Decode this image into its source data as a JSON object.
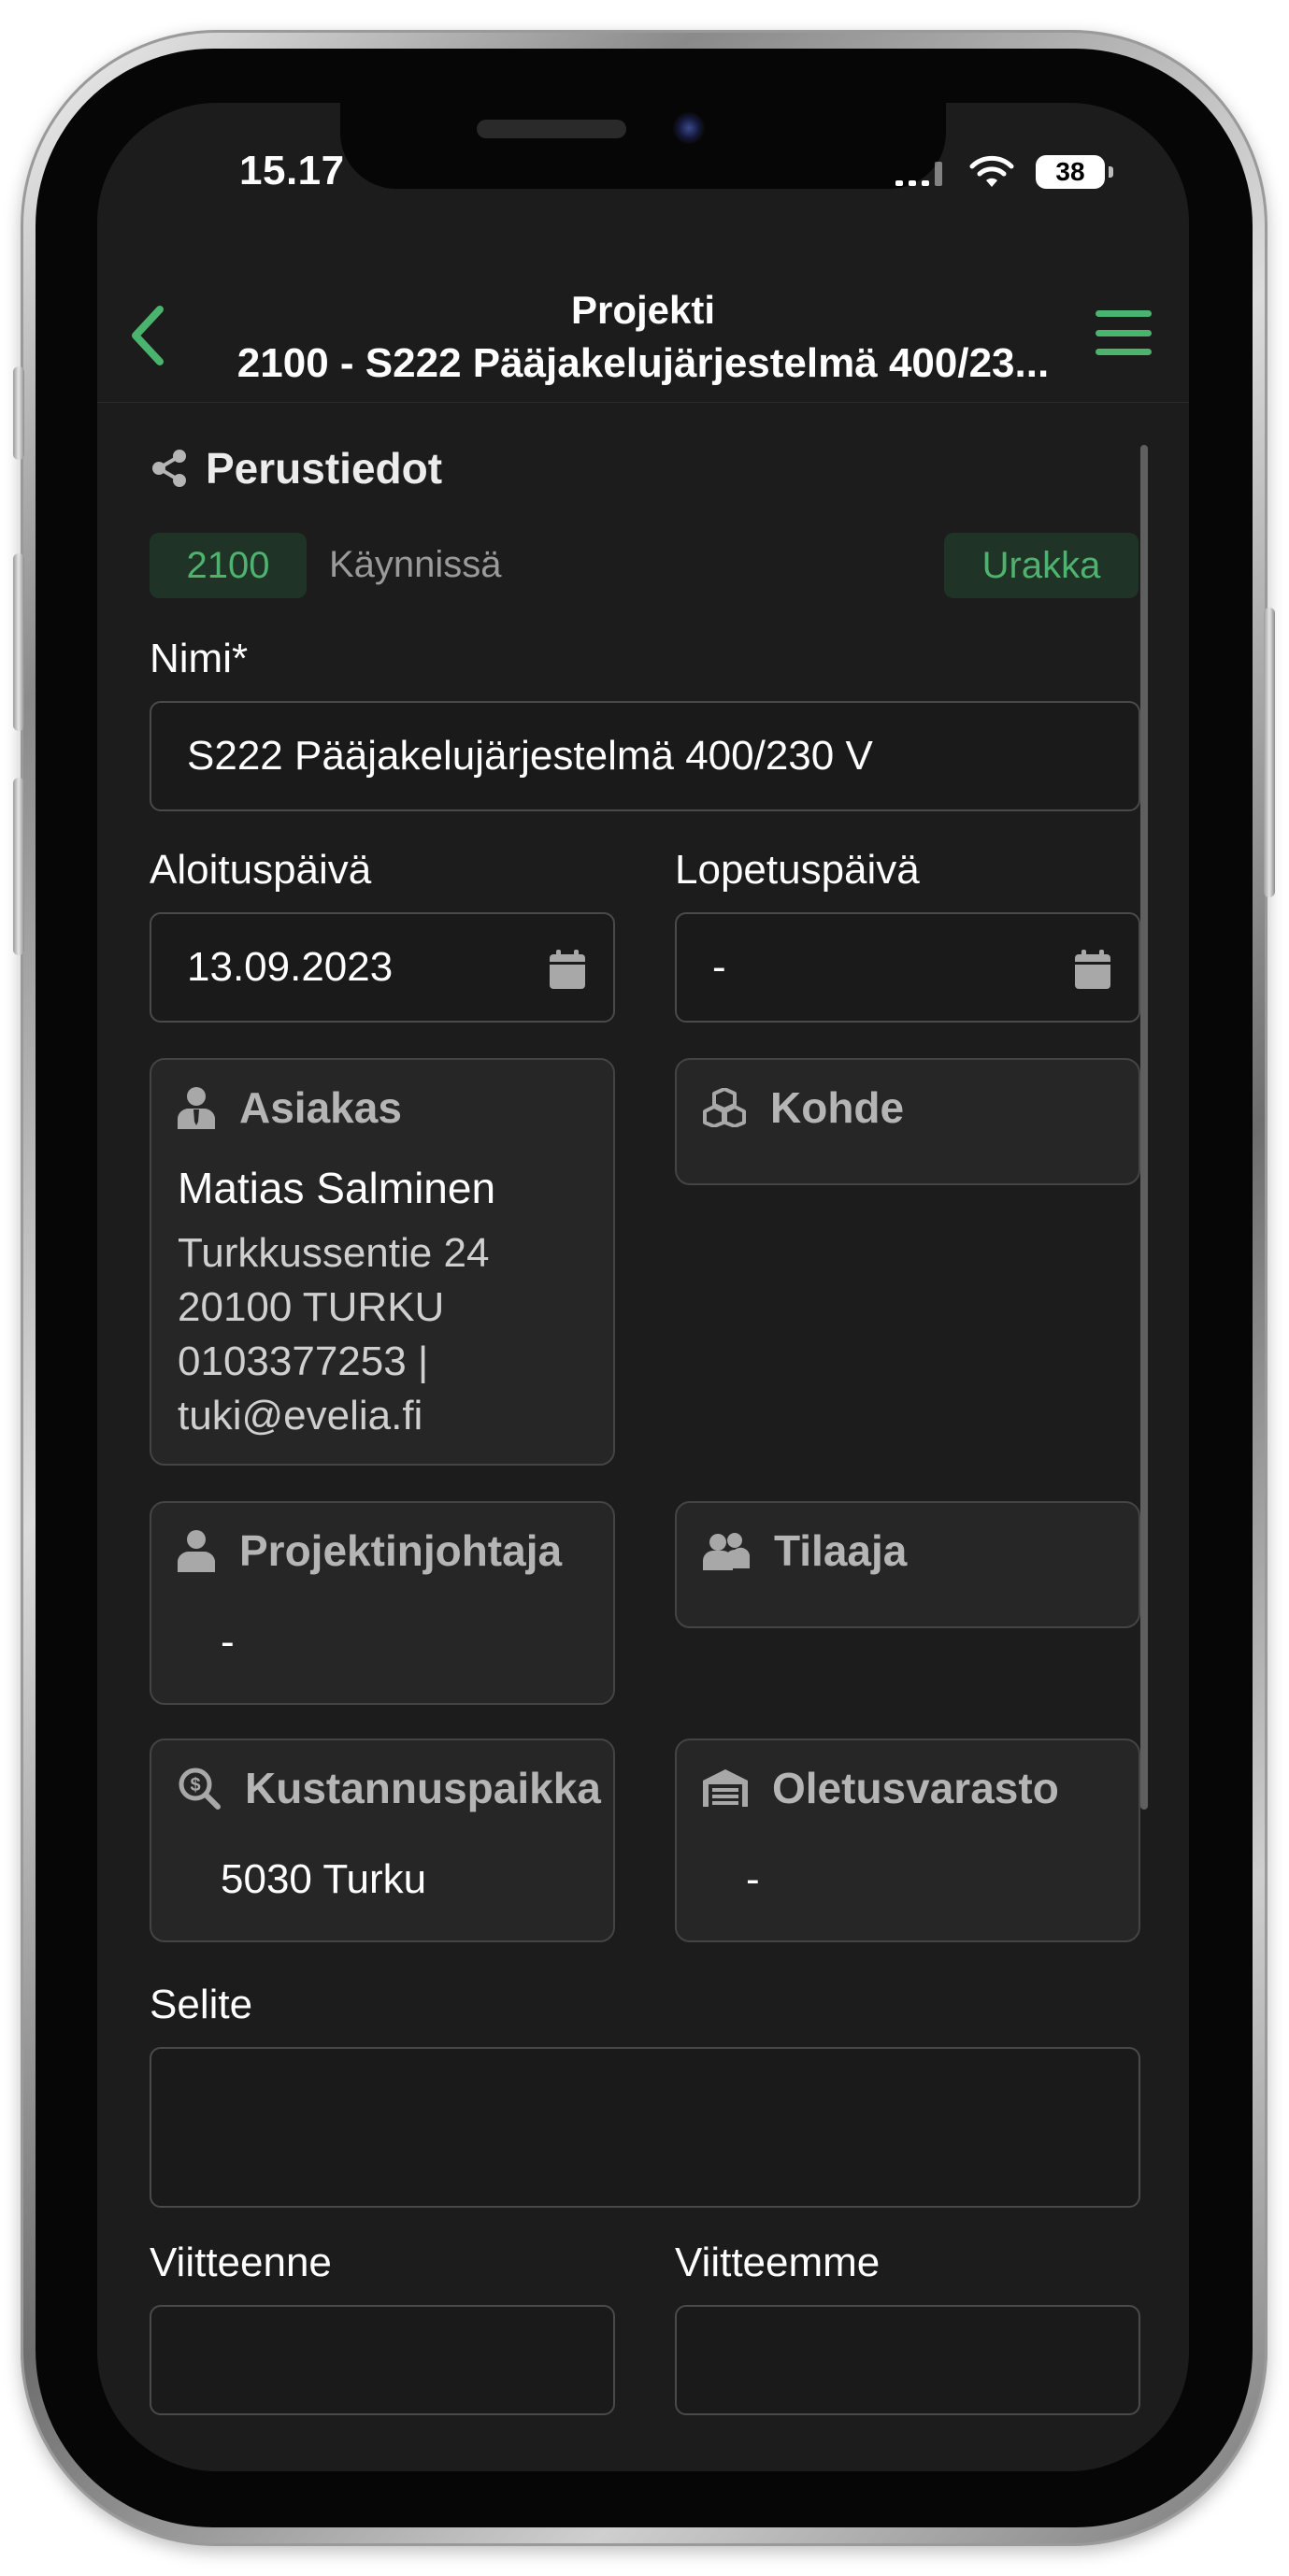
{
  "status_bar": {
    "time": "15.17",
    "battery": "38"
  },
  "header": {
    "title": "Projekti",
    "subtitle": "2100 - S222 Pääjakelujärjestelmä 400/23..."
  },
  "section": {
    "title": "Perustiedot"
  },
  "tags": {
    "number": "2100",
    "status": "Käynnissä",
    "type": "Urakka"
  },
  "form": {
    "name_label": "Nimi*",
    "name_value": "S222 Pääjakelujärjestelmä 400/230 V",
    "start_label": "Aloituspäivä",
    "start_value": "13.09.2023",
    "end_label": "Lopetuspäivä",
    "end_value": "-",
    "description_label": "Selite",
    "description_value": "",
    "your_ref_label": "Viitteenne",
    "our_ref_label": "Viitteemme"
  },
  "cards": {
    "customer": {
      "title": "Asiakas",
      "name": "Matias Salminen",
      "street": "Turkkussentie 24",
      "city": "20100 TURKU",
      "phone": "0103377253 |",
      "email": "tuki@evelia.fi"
    },
    "site": {
      "title": "Kohde"
    },
    "manager": {
      "title": "Projektinjohtaja",
      "value": "-"
    },
    "orderer": {
      "title": "Tilaaja"
    },
    "cost_center": {
      "title": "Kustannuspaikka",
      "value": "5030 Turku"
    },
    "warehouse": {
      "title": "Oletusvarasto",
      "value": "-"
    }
  },
  "colors": {
    "accent": "#4ab46f",
    "background": "#1c1c1c",
    "card": "#262626"
  }
}
